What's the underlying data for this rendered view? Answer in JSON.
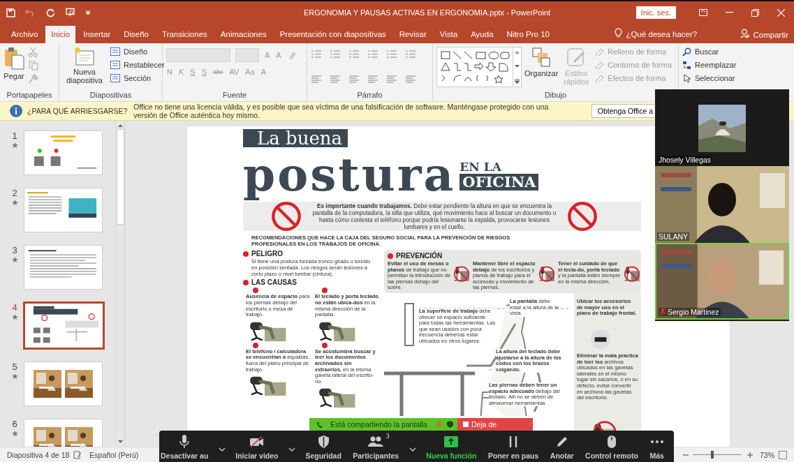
{
  "title_bar": {
    "title": "ERGONOMIA Y PAUSAS ACTIVAS EN ERGONOMIA.pptx  -  PowerPoint",
    "sign_in": "Inic. ses."
  },
  "tabs": [
    {
      "label": "Archivo",
      "selected": false
    },
    {
      "label": "Inicio",
      "selected": true
    },
    {
      "label": "Insertar",
      "selected": false
    },
    {
      "label": "Diseño",
      "selected": false
    },
    {
      "label": "Transiciones",
      "selected": false
    },
    {
      "label": "Animaciones",
      "selected": false
    },
    {
      "label": "Presentación con diapositivas",
      "selected": false
    },
    {
      "label": "Revisar",
      "selected": false
    },
    {
      "label": "Vista",
      "selected": false
    },
    {
      "label": "Ayuda",
      "selected": false
    },
    {
      "label": "Nitro Pro 10",
      "selected": false
    }
  ],
  "tell_me": "¿Qué desea hacer?",
  "share": "Compartir",
  "ribbon": {
    "clipboard": {
      "label": "Portapapeles",
      "paste": "Pegar"
    },
    "slides": {
      "label": "Diapositivas",
      "new_slide": "Nueva diapositiva",
      "items": [
        "Diseño",
        "Restablecer",
        "Sección"
      ]
    },
    "font": {
      "label": "Fuente",
      "disabled": true,
      "row1": [
        "A",
        "A"
      ],
      "row2": [
        "N",
        "K",
        "S",
        "S",
        "abc",
        "AV",
        "Aa",
        "A"
      ]
    },
    "paragraph": {
      "label": "Párrafo",
      "disabled": true
    },
    "drawing": {
      "label": "Dibujo",
      "arrange": "Organizar",
      "quick_styles": "Estilos rápidos",
      "format_items": [
        {
          "label": "Relleno de forma",
          "disabled": true
        },
        {
          "label": "Contorno de forma",
          "disabled": true
        },
        {
          "label": "Efectos de forma",
          "disabled": true
        }
      ]
    },
    "editing": {
      "items": [
        "Buscar",
        "Reemplazar",
        "Seleccionar"
      ]
    }
  },
  "info_bar": {
    "title": "¿PARA QUÉ ARRIESGARSE?",
    "message": "Office no tiene una licencia válida, y es posible que sea víctima de una falsificación de software. Manténgase protegido con una versión de Office auténtica hoy mismo.",
    "button": "Obtenga Office a"
  },
  "slides": [
    {
      "number": "1",
      "kind": "title",
      "selected": false
    },
    {
      "number": "2",
      "kind": "text_image",
      "selected": false
    },
    {
      "number": "3",
      "kind": "text",
      "selected": false
    },
    {
      "number": "4",
      "kind": "infographic",
      "selected": true
    },
    {
      "number": "5",
      "kind": "photos",
      "selected": false
    },
    {
      "number": "6",
      "kind": "photos",
      "selected": false
    }
  ],
  "slide": {
    "title_top": "La buena",
    "title_main": "postura",
    "title_sub1": "EN LA",
    "title_sub2": "OFICINA",
    "intro": "**Es importante cuando trabajamos.** Debe estar pendiente la altura en que se encuentra la pantalla de la computadora, la silla que utiliza, qué movimiento hace al buscar un documento o hasta cómo contesta el teléfono porque podría lesionarse la espalda, provocarse lesiones lumbares y en el cuello.",
    "recommendations": "RECOMENDACIONES QUE HACE LA CAJA DEL SEGURO SOCIAL PARA LA PREVENCIÓN DE RIESGOS PROFESIONALES EN LOS TRABAJOS DE OFICINA.",
    "danger": {
      "heading": "PELIGRO",
      "text": "Si tiene una postura forzada tronco girado o torcido en posición sentada. Los riesgos serán lesiones  a corto plazo o nivel lumbar (cintura)."
    },
    "causes": {
      "heading": "LAS CAUSAS",
      "items": [
        "**Ausencia de espacio** para los piernas debajo del escritorio o mesa de trabajo.",
        "**El teclado y porta teclado no están ubica-dos** en la misma dirección de la pantalla.",
        "**El teléfono / calculadora se encuentran a** espaldas, fuera del plano principal de trabajo.",
        "**Se acostumbra buscar y leer los documentos archivados sin extraerlos,** en la misma gaveta lateral del escrito-rio."
      ]
    },
    "prevention": {
      "heading": "PREVENCIÓN",
      "items": [
        "**Evitar el uso de mesas o planos** de trabajo que no permitan la introducción de las piernas debajo del sobre.",
        "**Mantener libre el espacio debajo** de los escritorios y planos de trabajo para el acomodo y movimiento de las piernas.",
        "**Tener el cuidado de que el tecla-do, porta teclado** y la pantalla estén siempre en la misma dirección."
      ]
    },
    "figure_notes": [
      "**La superficie de trabajo** debe ofrecer un espacio suficiente para todas las herramientas. Las que sean usados con poca frecuencia deberías estar ubicados en otros lugares.",
      "**La pantalla** debe estar a la altura de la vista.",
      "**La altura del teclado debe ajustarse a la altura de los codos con los brazos colgando.**",
      "**Las piernas deben tener un espacio adecuado** debajo del teclado. Allí no se deben de almacenar herramientas"
    ],
    "side_notes": [
      "**Ubicar los accesorios de mayor uso en el plano de trabajo frontal.**",
      "**Eliminar la mala practica de leer los** archivos ubicados en las gavetas laterales en el mismo lugar sin sacarlos, o en su defecto, evitar convertir en archivos las gavetas del escritorio."
    ]
  },
  "status_bar": {
    "slide_position": "Diapositiva 4 de 18",
    "language": "Español (Perú)",
    "zoom": "73%",
    "level": 0.4
  },
  "meeting": {
    "share_banner": {
      "text": "Está compartiendo la pantalla",
      "stop": "Deja de"
    },
    "toolbar": [
      {
        "kind": "mic",
        "label": "Desactivar au",
        "caret": true
      },
      {
        "kind": "video",
        "label": "Iniciar video",
        "caret": true
      },
      {
        "kind": "security",
        "label": "Seguridad",
        "caret": false
      },
      {
        "kind": "participants",
        "label": "Participantes",
        "count": "3",
        "caret": true
      },
      {
        "kind": "new",
        "label": "Nueva función",
        "caret": false
      },
      {
        "kind": "pause",
        "label": "Poner en paus",
        "caret": false
      },
      {
        "kind": "annotate",
        "label": "Anotar",
        "caret": false
      },
      {
        "kind": "remote",
        "label": "Control remoto",
        "caret": false
      },
      {
        "kind": "more",
        "label": "Más",
        "caret": false
      }
    ],
    "videos": [
      {
        "name": "Jhosely Villegas",
        "kind": "small",
        "muted": false,
        "speaking": false
      },
      {
        "name": "SULANY",
        "kind": "full",
        "muted": false,
        "speaking": false
      },
      {
        "name": "Sergio Martinez",
        "kind": "full",
        "muted": true,
        "speaking": true
      }
    ]
  }
}
